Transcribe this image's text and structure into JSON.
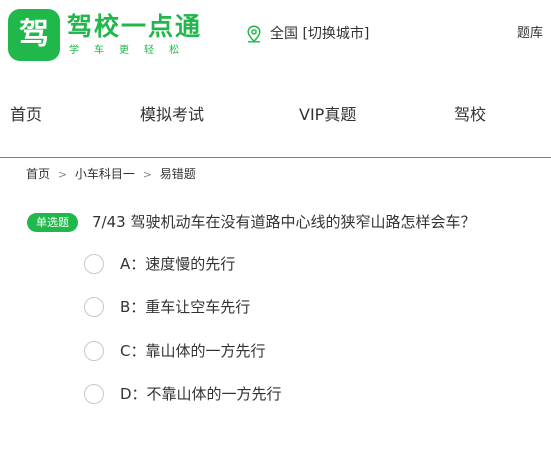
{
  "header": {
    "logo_char": "驾",
    "brand": "驾校一点通",
    "slogan": "学车更轻松",
    "city_current": "全国",
    "city_switch": "[切换城市]",
    "question_bank": "题库",
    "location_icon": "location-pin-icon"
  },
  "nav": {
    "items": [
      {
        "label": "首页"
      },
      {
        "label": "模拟考试"
      },
      {
        "label": "VIP真题"
      },
      {
        "label": "驾校"
      }
    ]
  },
  "breadcrumb": {
    "items": [
      "首页",
      "小车科目一",
      "易错题"
    ],
    "separator": ">"
  },
  "question": {
    "type_badge": "单选题",
    "text": "7/43 驾驶机动车在没有道路中心线的狭窄山路怎样会车？",
    "options": [
      {
        "label": "A：速度慢的先行"
      },
      {
        "label": "B：重车让空车先行"
      },
      {
        "label": "C：靠山体的一方先行"
      },
      {
        "label": "D：不靠山体的一方先行"
      }
    ]
  },
  "colors": {
    "brand_green": "#20b84a",
    "text": "#333333",
    "radio_border": "#c8c8c8"
  }
}
